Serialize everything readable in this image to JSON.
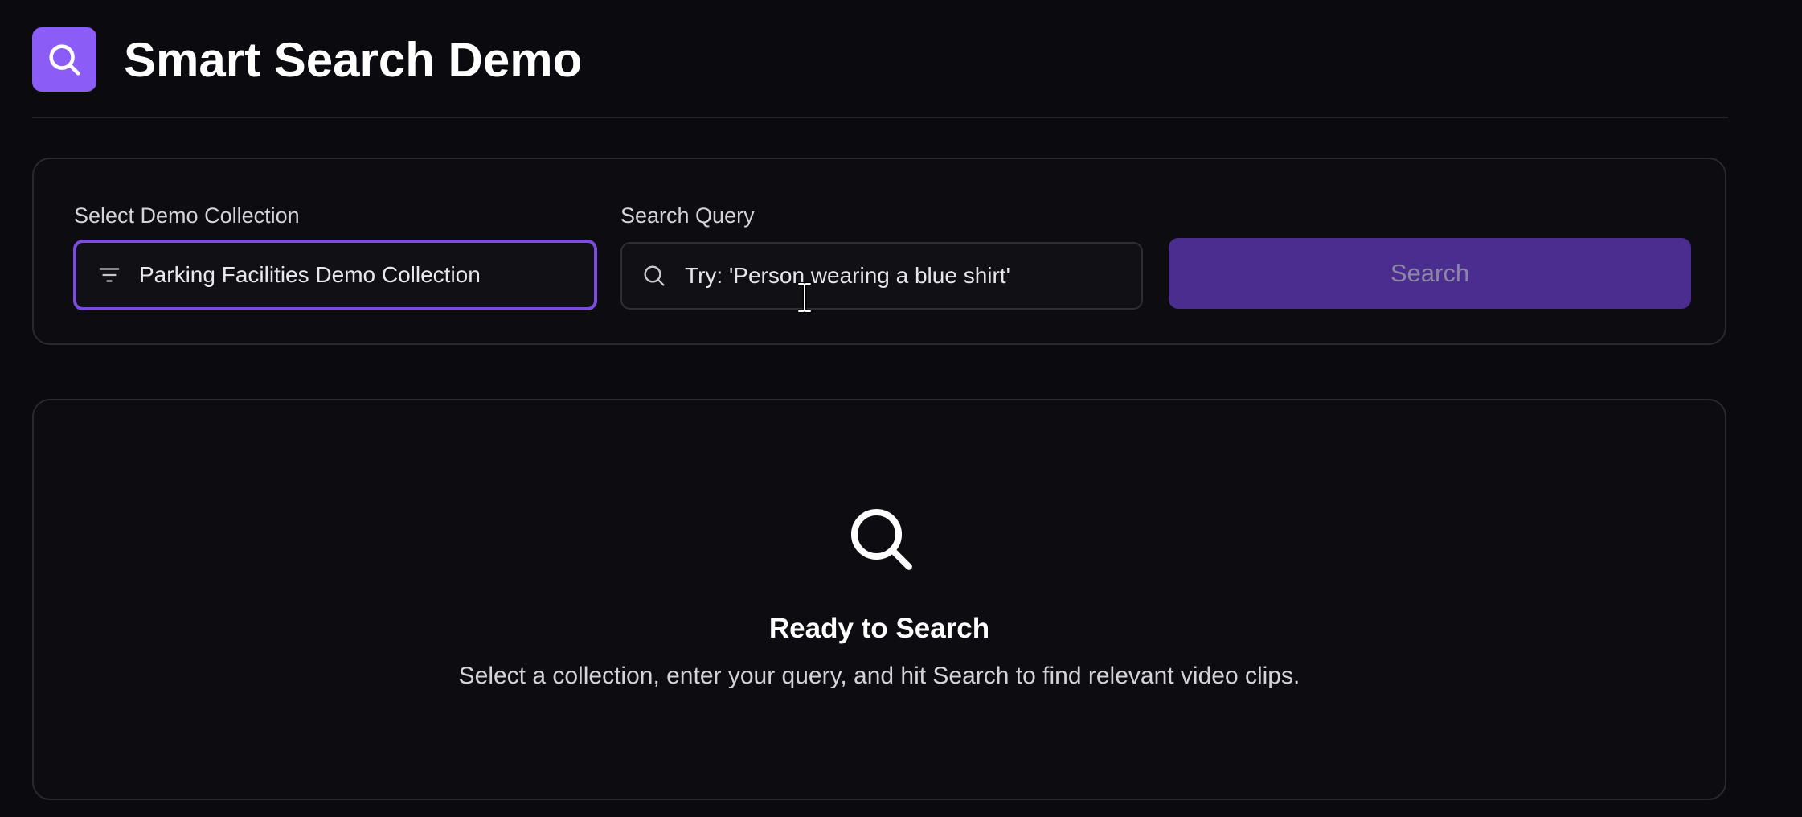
{
  "header": {
    "title": "Smart Search Demo",
    "logo_icon": "search-icon",
    "accent_color": "#8b5cf6"
  },
  "search_panel": {
    "collection_label": "Select Demo Collection",
    "collection_value": "Parking Facilities Demo Collection",
    "collection_icon": "filter-icon",
    "query_label": "Search Query",
    "query_placeholder": "Try: 'Person wearing a blue shirt'",
    "query_value": "",
    "query_icon": "search-icon",
    "search_button_label": "Search",
    "search_button_color": "#4a2d8e",
    "search_button_enabled": false
  },
  "empty_state": {
    "icon": "search-icon",
    "title": "Ready to Search",
    "description": "Select a collection, enter your query, and hit Search to find relevant video clips."
  }
}
